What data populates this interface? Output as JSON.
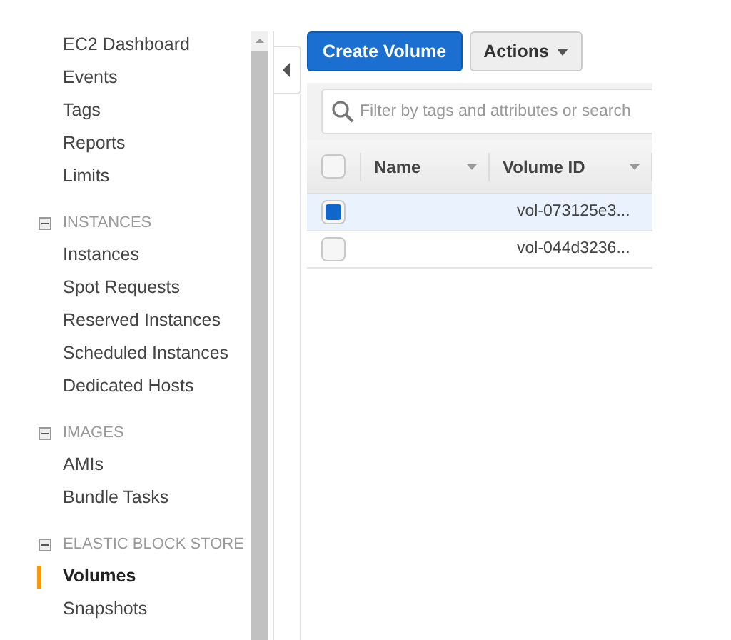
{
  "sidebar": {
    "sections": [
      {
        "items": [
          {
            "label": "EC2 Dashboard",
            "selected": false
          },
          {
            "label": "Events",
            "selected": false
          },
          {
            "label": "Tags",
            "selected": false
          },
          {
            "label": "Reports",
            "selected": false
          },
          {
            "label": "Limits",
            "selected": false
          }
        ]
      },
      {
        "title": "INSTANCES",
        "expanded": true,
        "items": [
          {
            "label": "Instances",
            "selected": false
          },
          {
            "label": "Spot Requests",
            "selected": false
          },
          {
            "label": "Reserved Instances",
            "selected": false
          },
          {
            "label": "Scheduled Instances",
            "selected": false
          },
          {
            "label": "Dedicated Hosts",
            "selected": false
          }
        ]
      },
      {
        "title": "IMAGES",
        "expanded": true,
        "items": [
          {
            "label": "AMIs",
            "selected": false
          },
          {
            "label": "Bundle Tasks",
            "selected": false
          }
        ]
      },
      {
        "title": "ELASTIC BLOCK STORE",
        "expanded": true,
        "items": [
          {
            "label": "Volumes",
            "selected": true
          },
          {
            "label": "Snapshots",
            "selected": false
          }
        ]
      }
    ]
  },
  "toolbar": {
    "primary_button": "Create Volume",
    "actions_button": "Actions"
  },
  "filter": {
    "placeholder": "Filter by tags and attributes or search"
  },
  "table": {
    "select_all": {
      "checked": false
    },
    "columns": [
      "Name",
      "Volume ID"
    ],
    "rows": [
      {
        "selected": true,
        "volume_id": "vol-073125e3..."
      },
      {
        "selected": false,
        "volume_id": "vol-044d3236..."
      }
    ]
  }
}
